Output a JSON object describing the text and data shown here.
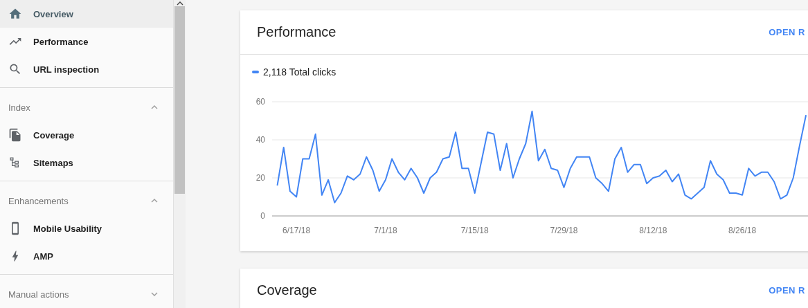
{
  "sidebar": {
    "items": [
      {
        "label": "Overview",
        "selected": true
      },
      {
        "label": "Performance",
        "selected": false
      },
      {
        "label": "URL inspection",
        "selected": false
      }
    ],
    "sections": [
      {
        "title": "Index",
        "expanded": true,
        "items": [
          {
            "label": "Coverage",
            "selected": false
          },
          {
            "label": "Sitemaps",
            "selected": false
          }
        ]
      },
      {
        "title": "Enhancements",
        "expanded": true,
        "items": [
          {
            "label": "Mobile Usability",
            "selected": false
          },
          {
            "label": "AMP",
            "selected": false
          }
        ]
      },
      {
        "title": "Manual actions",
        "expanded": false
      }
    ]
  },
  "cards": [
    {
      "title": "Performance",
      "action": "OPEN R",
      "legend_total": "2,118",
      "chart_data": {
        "type": "line",
        "categories": [
          null,
          null,
          null,
          "6/17/18",
          null,
          null,
          null,
          null,
          null,
          null,
          null,
          null,
          null,
          null,
          null,
          null,
          null,
          "7/1/18",
          null,
          null,
          null,
          null,
          null,
          null,
          null,
          null,
          null,
          null,
          null,
          null,
          null,
          "7/15/18",
          null,
          null,
          null,
          null,
          null,
          null,
          null,
          null,
          null,
          null,
          null,
          null,
          null,
          "7/29/18",
          null,
          null,
          null,
          null,
          null,
          null,
          null,
          null,
          null,
          null,
          null,
          null,
          null,
          "8/12/18",
          null,
          null,
          null,
          null,
          null,
          null,
          null,
          null,
          null,
          null,
          null,
          null,
          null,
          "8/26/18",
          null,
          null,
          null,
          null,
          null,
          null,
          null,
          null,
          null,
          null
        ],
        "series": [
          {
            "name": "Total clicks",
            "color": "#4285f4",
            "values": [
              16,
              36,
              13,
              10,
              30,
              30,
              43,
              11,
              19,
              7,
              12,
              21,
              19,
              22,
              31,
              24,
              13,
              19,
              30,
              23,
              19,
              25,
              20,
              12,
              20,
              23,
              30,
              31,
              44,
              25,
              25,
              12,
              28,
              44,
              43,
              24,
              38,
              20,
              30,
              38,
              55,
              29,
              35,
              25,
              24,
              15,
              25,
              31,
              31,
              31,
              20,
              17,
              13,
              30,
              36,
              23,
              27,
              27,
              17,
              20,
              21,
              24,
              18,
              22,
              11,
              9,
              12,
              15,
              29,
              22,
              19,
              12,
              12,
              11,
              25,
              21,
              23,
              23,
              18,
              9,
              11,
              20,
              37,
              53
            ]
          }
        ],
        "ylim": [
          0,
          60
        ],
        "yticks": [
          0,
          20,
          40,
          60
        ]
      }
    },
    {
      "title": "Coverage",
      "action": "OPEN R"
    }
  ]
}
